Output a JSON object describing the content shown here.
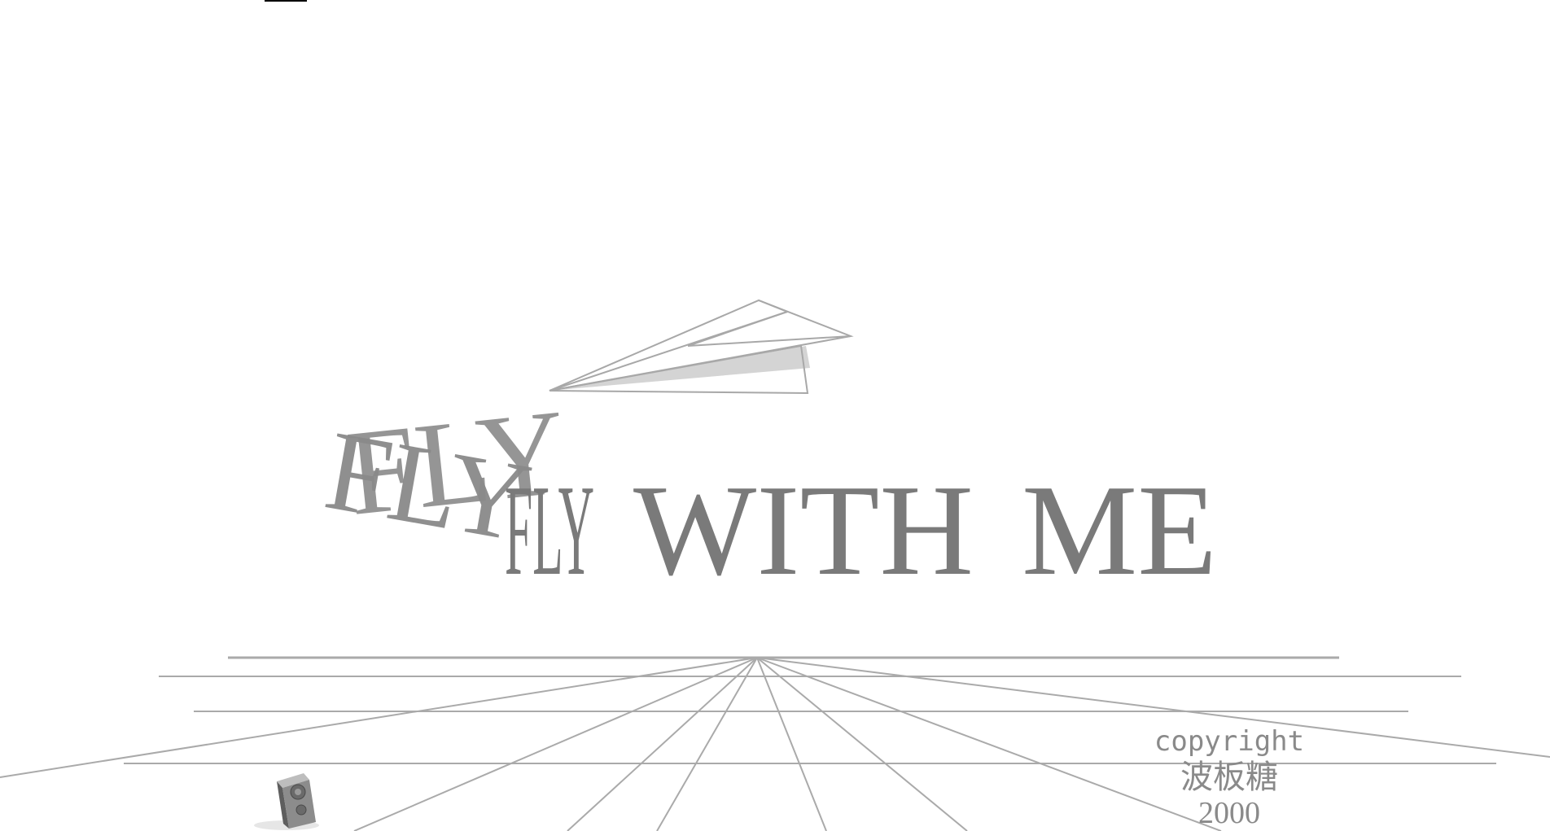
{
  "title": {
    "word_fly": "FLY",
    "word_with": "WITH",
    "word_me": "ME"
  },
  "credits": {
    "copyright_label": "copyright",
    "author": "波板糖",
    "year": "2000"
  },
  "icons": {
    "plane": "paper-plane-icon",
    "speaker": "speaker-icon"
  },
  "colors": {
    "text": "#7a7a7a",
    "lines": "#aaaaaa",
    "background": "#ffffff"
  }
}
